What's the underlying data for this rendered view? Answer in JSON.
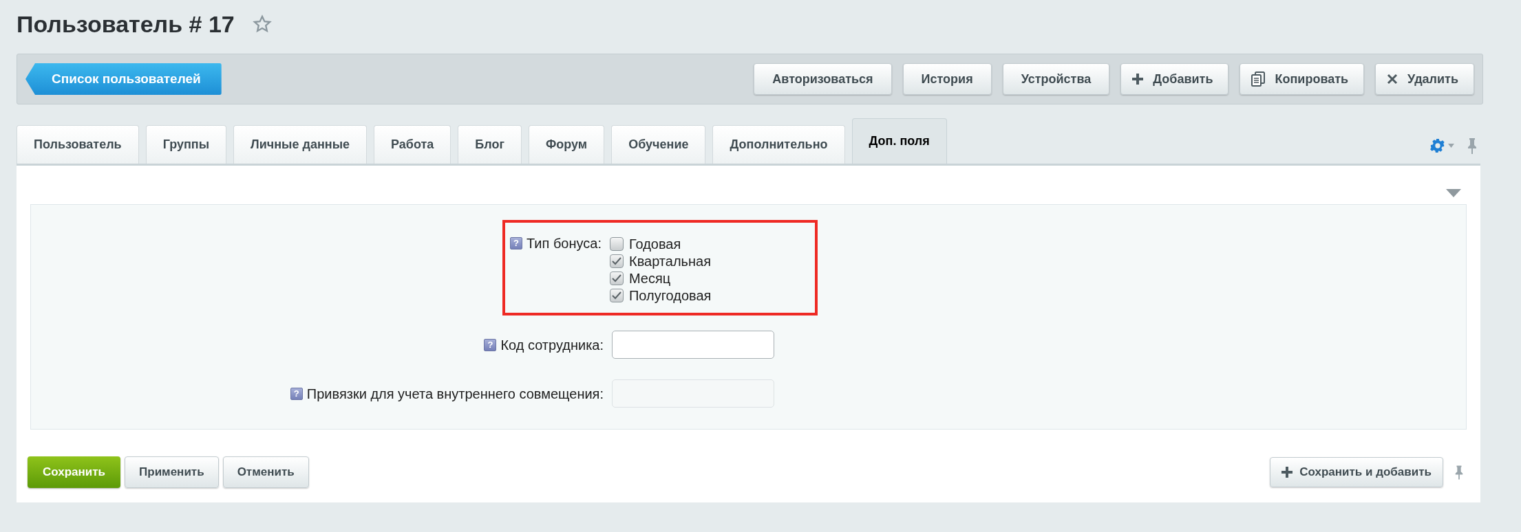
{
  "page_title": "Пользователь # 17",
  "back_button": "Список пользователей",
  "toolbar": [
    {
      "label": "Авторизоваться",
      "kind": "plain"
    },
    {
      "label": "История",
      "kind": "plain"
    },
    {
      "label": "Устройства",
      "kind": "plain"
    },
    {
      "label": "Добавить",
      "kind": "add"
    },
    {
      "label": "Копировать",
      "kind": "copy"
    },
    {
      "label": "Удалить",
      "kind": "delete"
    }
  ],
  "tabs": [
    {
      "label": "Пользователь",
      "selected": false
    },
    {
      "label": "Группы",
      "selected": false
    },
    {
      "label": "Личные данные",
      "selected": false
    },
    {
      "label": "Работа",
      "selected": false
    },
    {
      "label": "Блог",
      "selected": false
    },
    {
      "label": "Форум",
      "selected": false
    },
    {
      "label": "Обучение",
      "selected": false
    },
    {
      "label": "Дополнительно",
      "selected": false
    },
    {
      "label": "Доп. поля",
      "selected": true
    }
  ],
  "fields": [
    {
      "kind": "checkboxes",
      "help": "?",
      "label": "Тип бонуса:",
      "highlighted": true,
      "options": [
        {
          "label": "Годовая",
          "checked": false
        },
        {
          "label": "Квартальная",
          "checked": true
        },
        {
          "label": "Месяц",
          "checked": true
        },
        {
          "label": "Полугодовая",
          "checked": true
        }
      ]
    },
    {
      "kind": "text",
      "help": "?",
      "label": "Код сотрудника:",
      "disabled": false
    },
    {
      "kind": "text",
      "help": "?",
      "label": "Привязки для учета внутреннего совмещения:",
      "disabled": true
    }
  ],
  "footer_buttons": [
    {
      "label": "Сохранить",
      "kind": "primary"
    },
    {
      "label": "Применить",
      "kind": "normal"
    },
    {
      "label": "Отменить",
      "kind": "normal"
    }
  ],
  "footer_right_button": "Сохранить и добавить"
}
